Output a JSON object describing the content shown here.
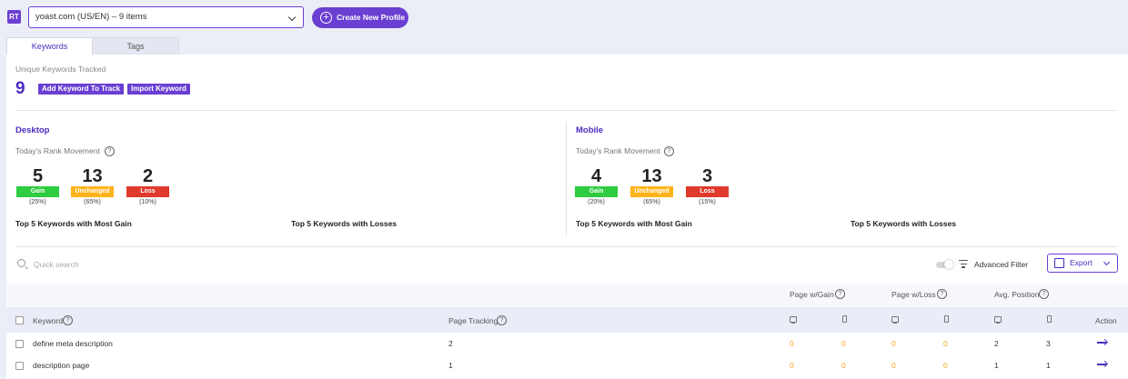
{
  "topbar": {
    "logo_text": "RT",
    "profile_select_value": "yoast.com (US/EN) – 9 items",
    "create_profile_label": "Create New Profile"
  },
  "tabs": [
    {
      "label": "Keywords",
      "active": true
    },
    {
      "label": "Tags",
      "active": false
    }
  ],
  "summary": {
    "unique_label": "Unique Keywords Tracked",
    "unique_count": "9",
    "add_keyword_label": "Add Keyword To Track",
    "import_keyword_label": "Import Keyword"
  },
  "desktop": {
    "title": "Desktop",
    "movement_label": "Today's Rank Movement",
    "gain": {
      "value": "5",
      "label": "Gain",
      "pct": "(25%)"
    },
    "unchanged": {
      "value": "13",
      "label": "Unchanged",
      "pct": "(65%)"
    },
    "loss": {
      "value": "2",
      "label": "Loss",
      "pct": "(10%)"
    },
    "top_gain_label": "Top 5 Keywords with Most Gain",
    "top_loss_label": "Top 5 Keywords with Losses"
  },
  "mobile": {
    "title": "Mobile",
    "movement_label": "Today's Rank Movement",
    "gain": {
      "value": "4",
      "label": "Gain",
      "pct": "(20%)"
    },
    "unchanged": {
      "value": "13",
      "label": "Unchanged",
      "pct": "(65%)"
    },
    "loss": {
      "value": "3",
      "label": "Loss",
      "pct": "(15%)"
    },
    "top_gain_label": "Top 5 Keywords with Most Gain",
    "top_loss_label": "Top 5 Keywords with Losses"
  },
  "toolbar": {
    "search_placeholder": "Quick search",
    "advanced_filter_label": "Advanced Filter",
    "export_label": "Export"
  },
  "table": {
    "group_headers": {
      "page_gain": "Page w/Gain",
      "page_loss": "Page w/Loss",
      "avg_position": "Avg. Position"
    },
    "headers": {
      "keyword": "Keyword",
      "page_tracking": "Page Tracking",
      "action": "Action"
    },
    "rows": [
      {
        "keyword": "define meta description",
        "page_tracking": "2",
        "gain_desktop": "0",
        "gain_mobile": "0",
        "loss_desktop": "0",
        "loss_mobile": "0",
        "avg_desktop": "2",
        "avg_mobile": "3"
      },
      {
        "keyword": "description page",
        "page_tracking": "1",
        "gain_desktop": "0",
        "gain_mobile": "0",
        "loss_desktop": "0",
        "loss_mobile": "0",
        "avg_desktop": "1",
        "avg_mobile": "1"
      }
    ]
  },
  "colors": {
    "accent": "#6a3fd1",
    "gain": "#2ecc40",
    "unchanged": "#ffb31a",
    "loss": "#e03a2c",
    "zero_value": "#f5a623"
  }
}
